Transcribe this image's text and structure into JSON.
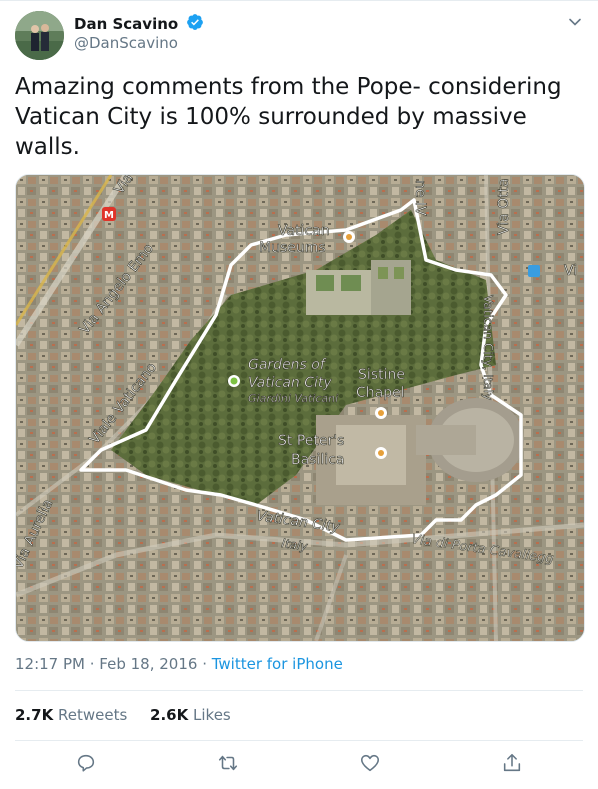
{
  "author": {
    "name": "Dan Scavino",
    "handle": "@DanScavino",
    "verified": true
  },
  "tweet": {
    "text": "Amazing comments from the Pope- considering Vatican City is 100% surrounded by massive walls."
  },
  "map": {
    "labels": {
      "via": "Via",
      "vatican_museums_1": "Vatican",
      "vatican_museums_2": "Museums",
      "gardens_1": "Gardens of",
      "gardens_2": "Vatican City",
      "gardens_3": "Giardini Vaticani",
      "sistine_1": "Sistine",
      "sistine_2": "Chapel",
      "st_peters_1": "St Peter's",
      "st_peters_2": "Basilica",
      "vatican_city": "Vatican City",
      "italy": "Italy",
      "via_angelo_emo": "Via Angelo Emo",
      "viale_vaticano": "Viale Vaticano",
      "via_aurelia": "Via Aurelia",
      "via_otto": "Via Otta",
      "vatican_city_italy": "Vatican City, Italy",
      "via_porta": "Via di Porta Cavallegg",
      "vi": "Vi",
      "ne_iv": "ne IV",
      "metro": "M"
    }
  },
  "meta": {
    "time": "12:17 PM",
    "separator": " · ",
    "date": "Feb 18, 2016",
    "source": "Twitter for iPhone"
  },
  "stats": {
    "retweets_count": "2.7K",
    "retweets_label": "Retweets",
    "likes_count": "2.6K",
    "likes_label": "Likes"
  },
  "colors": {
    "accent": "#1b95e0",
    "verified": "#1da1f2",
    "muted": "#657786",
    "text": "#14171a"
  },
  "icons": {
    "reply": "reply-icon",
    "retweet": "retweet-icon",
    "like": "heart-icon",
    "share": "share-icon",
    "caret": "chevron-down-icon"
  }
}
